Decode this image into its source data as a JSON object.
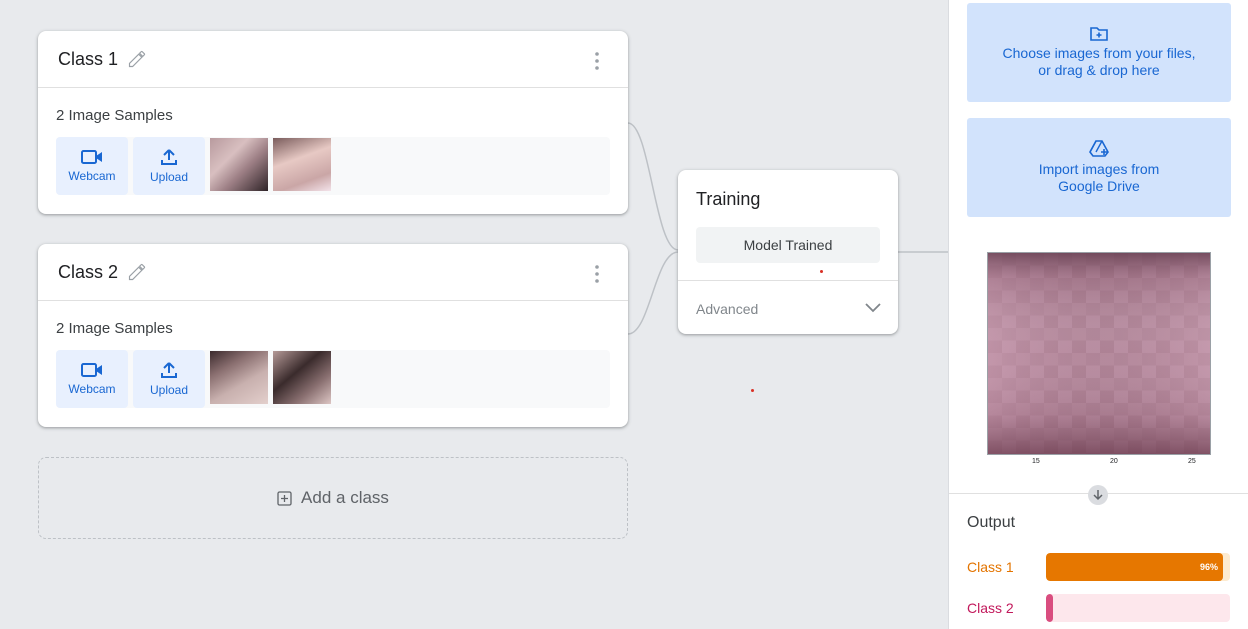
{
  "classes": [
    {
      "name": "Class 1",
      "samples_label": "2 Image Samples",
      "webcam_label": "Webcam",
      "upload_label": "Upload"
    },
    {
      "name": "Class 2",
      "samples_label": "2 Image Samples",
      "webcam_label": "Webcam",
      "upload_label": "Upload"
    }
  ],
  "add_class_label": "Add a class",
  "training": {
    "title": "Training",
    "button_label": "Model Trained",
    "advanced_label": "Advanced"
  },
  "upload_panel": {
    "choose_files_line1": "Choose images from your files,",
    "choose_files_line2": "or drag & drop here",
    "drive_line1": "Import images from",
    "drive_line2": "Google Drive",
    "preview_x_ticks": [
      "15",
      "20",
      "25"
    ]
  },
  "output": {
    "title": "Output",
    "predictions": [
      {
        "label": "Class 1",
        "percent_text": "96%",
        "fraction": 0.96,
        "color": "#e67700",
        "track_color": "#fdebd0",
        "label_color": "#e37400"
      },
      {
        "label": "Class 2",
        "percent_text": "",
        "fraction": 0.04,
        "color": "#d94d7f",
        "track_color": "#fde7ec",
        "label_color": "#c2185b"
      }
    ]
  },
  "icons": [
    "pencil-icon",
    "more-vert-icon",
    "videocam-icon",
    "upload-icon",
    "add-box-icon",
    "chevron-down-icon",
    "folder-add-icon",
    "google-drive-icon",
    "arrow-down-icon"
  ]
}
